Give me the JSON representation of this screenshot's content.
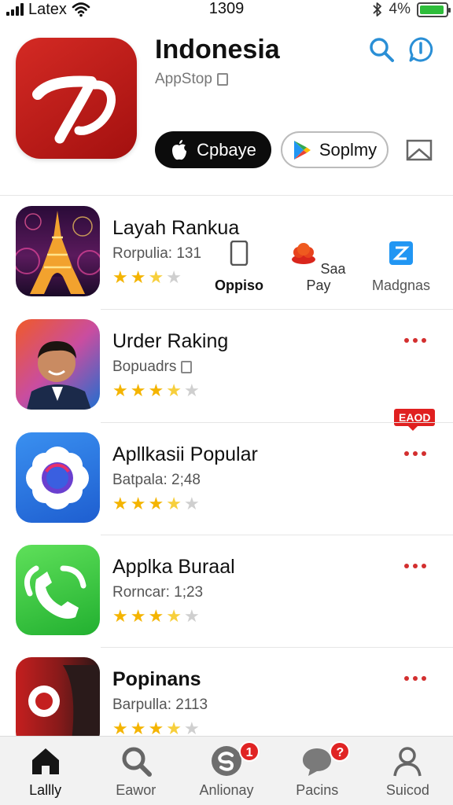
{
  "status_bar": {
    "carrier": "Latex",
    "time": "1309",
    "battery_text": "4%",
    "battery_level": 0.95,
    "icons": [
      "signal-icon",
      "wifi-icon",
      "bluetooth-icon",
      "battery-icon"
    ]
  },
  "header": {
    "title": "Indonesia",
    "subtitle": "AppStop",
    "apple_button_label": "Cpbaye",
    "play_button_label": "Soplmy",
    "icons": [
      "search-icon",
      "info-icon",
      "mail-icon"
    ]
  },
  "apps": [
    {
      "name": "Layah Rankua",
      "meta": "Rorpulia: 131",
      "rating": 2.5,
      "badge": "EAOD",
      "quick_actions": [
        {
          "label": "Oppiso",
          "icon": "phone-icon"
        },
        {
          "label": "Saa Pay",
          "icon": "cloud-pay-icon"
        },
        {
          "label": "Madgnas",
          "icon": "bolt-tile-icon"
        }
      ]
    },
    {
      "name": "Urder Raking",
      "meta": "Bopuadrs",
      "rating": 3.5
    },
    {
      "name": "Apllkasii Popular",
      "meta": "Batpala: 2;48",
      "rating": 3.5
    },
    {
      "name": "Applka Buraal",
      "meta": "Rorncar: 1;23",
      "rating": 3.5
    },
    {
      "name": "Popinans",
      "meta": "Barpulla: 2113",
      "rating": 3.5
    }
  ],
  "tab_bar": {
    "items": [
      {
        "label": "Lallly",
        "icon": "home-icon"
      },
      {
        "label": "Eawor",
        "icon": "search-icon"
      },
      {
        "label": "Anlionay",
        "icon": "refresh-icon",
        "badge": "1"
      },
      {
        "label": "Pacins",
        "icon": "chat-icon",
        "badge": "?"
      },
      {
        "label": "Suicod",
        "icon": "profile-icon"
      }
    ],
    "active_index": 0
  },
  "colors": {
    "accent_blue": "#2a8fd6",
    "brand_red": "#d42a24",
    "star_gold": "#f4b400",
    "menu_red": "#d32f2f"
  }
}
